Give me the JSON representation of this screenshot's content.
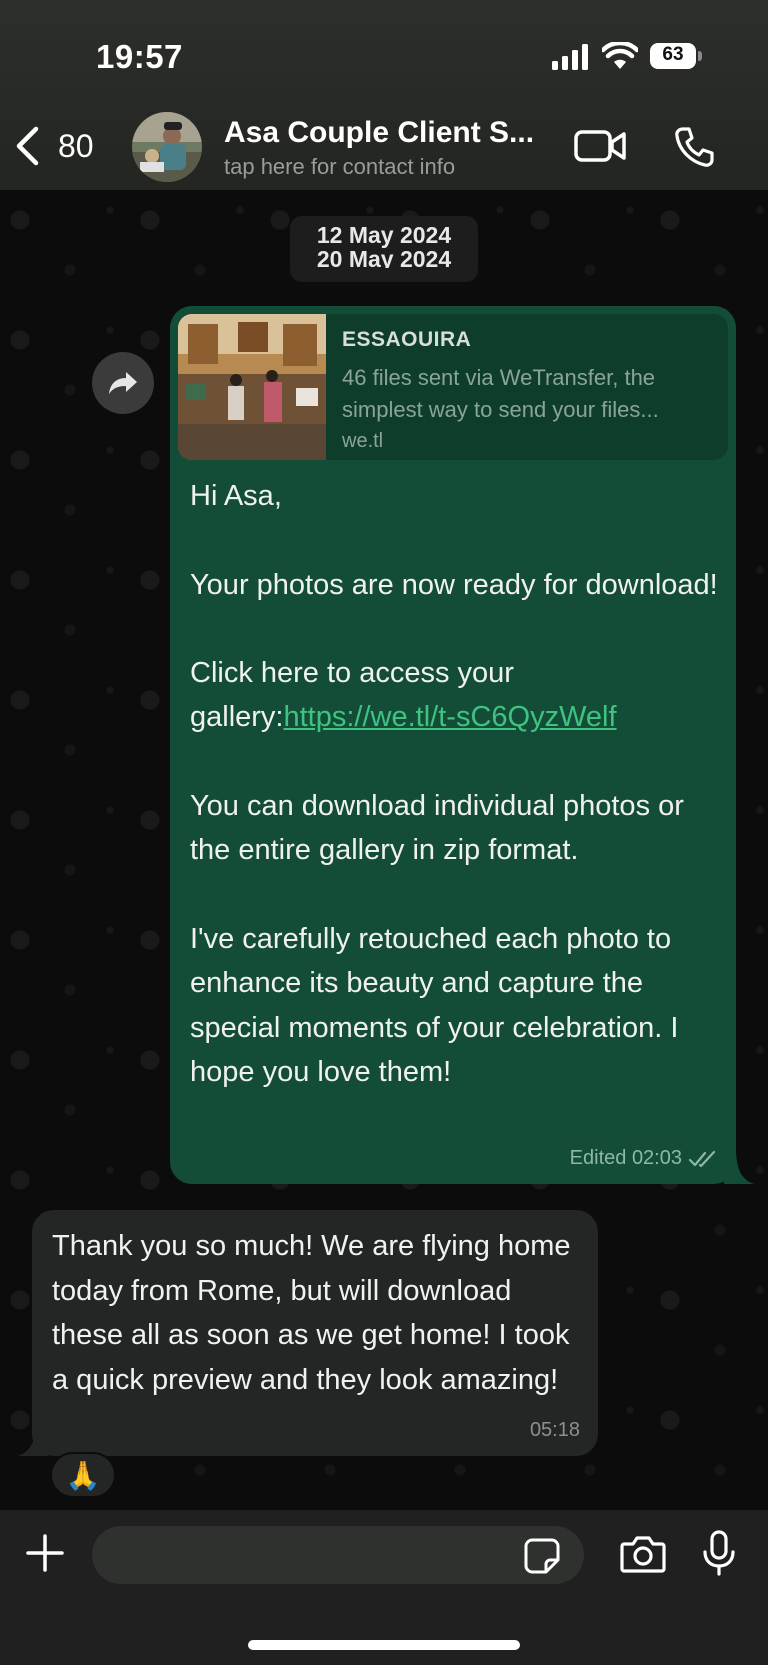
{
  "status": {
    "time": "19:57",
    "battery": "63"
  },
  "header": {
    "back_count": "80",
    "contact_name": "Asa Couple Client S...",
    "contact_sub": "tap here for contact info"
  },
  "date_pill": {
    "line1": "12 May 2024",
    "line2": "20 May 2024"
  },
  "outgoing": {
    "link_preview": {
      "title": "ESSAOUIRA",
      "description": "46 files sent via WeTransfer, the simplest way to send your files...",
      "domain": "we.tl"
    },
    "p1": "Hi Asa,",
    "p2": "Your photos are now ready for download!",
    "p3_prefix": "Click here to access your gallery:",
    "p3_link": "https://we.tl/t-sC6QyzWelf",
    "p4": "You can download individual photos or the entire gallery in zip format.",
    "p5": "I've carefully retouched each photo to enhance its beauty and capture the special moments of your celebration. I hope you love them!",
    "meta": "Edited 02:03"
  },
  "incoming": {
    "text": "Thank you so much! We are flying home today from Rome, but will download these all as soon as we get home! I took a quick preview and they look amazing!",
    "time": "05:18",
    "reaction": "🙏"
  },
  "icons": {
    "back": "chevron-left-icon",
    "video": "video-camera-icon",
    "call": "phone-icon",
    "forward": "forward-arrow-icon",
    "plus": "plus-icon",
    "sticker": "sticker-icon",
    "camera": "camera-icon",
    "mic": "microphone-icon",
    "read": "double-check-icon"
  },
  "colors": {
    "outgoing_bubble": "#144d37",
    "incoming_bubble": "#242625",
    "link": "#3fc383"
  }
}
